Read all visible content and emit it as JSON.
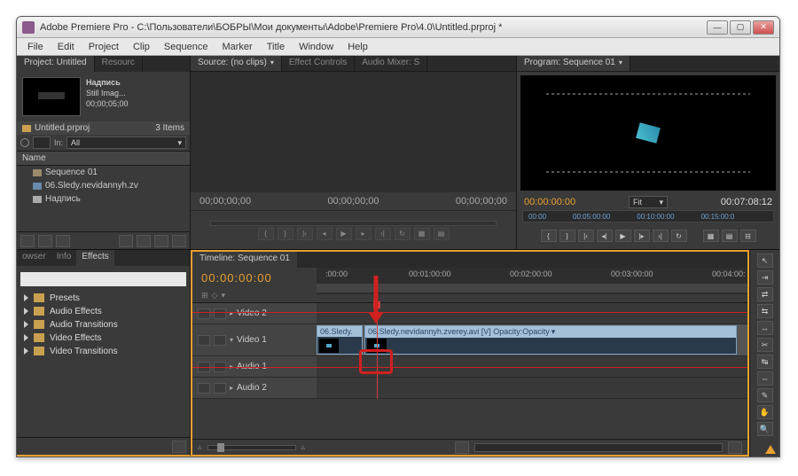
{
  "title": "Adobe Premiere Pro - C:\\Пользователи\\БОБРЫ\\Мои документы\\Adobe\\Premiere Pro\\4.0\\Untitled.prproj *",
  "menu": [
    "File",
    "Edit",
    "Project",
    "Clip",
    "Sequence",
    "Marker",
    "Title",
    "Window",
    "Help"
  ],
  "project": {
    "tab1": "Project: Untitled",
    "tab2": "Resourc",
    "asset_name": "Надпись",
    "asset_type": "Still Imag...",
    "asset_dur": "00;00;05;00",
    "bin_name": "Untitled.prproj",
    "item_count": "3 Items",
    "in_label": "In:",
    "in_value": "All",
    "header_name": "Name",
    "items": [
      "Sequence 01",
      "06.Sledy.nevidannyh.zv",
      "Надпись"
    ]
  },
  "source": {
    "tab_source": "Source: (no clips)",
    "tab_effect": "Effect Controls",
    "tab_audio": "Audio Mixer: S",
    "tc_left": "00;00;00;00",
    "tc_right": "00;00;00;00"
  },
  "program": {
    "tab": "Program: Sequence 01",
    "tc_cur": "00:00:00:00",
    "fit": "Fit",
    "tc_dur": "00:07:08:12",
    "ruler": [
      "00:00",
      "00:05:00:00",
      "00:10:00:00",
      "00:15:00:0"
    ]
  },
  "effects": {
    "tabs": [
      "owser",
      "Info",
      "Effects"
    ],
    "items": [
      "Presets",
      "Audio Effects",
      "Audio Transitions",
      "Video Effects",
      "Video Transitions"
    ]
  },
  "timeline": {
    "tab": "Timeline: Sequence 01",
    "tc": "00:00:00:00",
    "ruler": [
      ":00:00",
      "00:01:00:00",
      "00:02:00:00",
      "00:03:00:00",
      "00:04:00:"
    ],
    "track_v2": "Video 2",
    "track_v1": "Video 1",
    "track_a1": "Audio 1",
    "track_a2": "Audio 2",
    "clip1_name": "06.Sledy.",
    "clip2_name": "06.Sledy.nevidannyh.zverey.avi [V]",
    "clip2_opacity": "Opacity:Opacity"
  }
}
